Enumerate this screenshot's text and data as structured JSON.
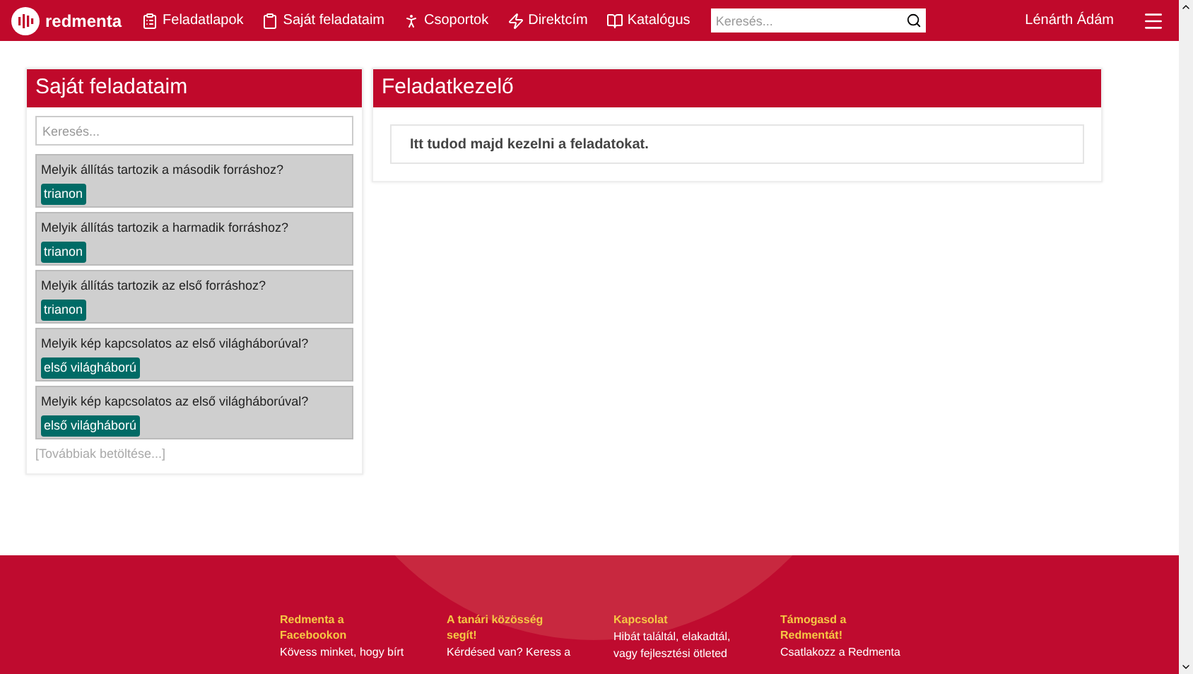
{
  "navbar": {
    "logo": "redmenta",
    "items": [
      {
        "label": "Feladatlapok",
        "kind": "worksheets"
      },
      {
        "label": "Saját feladataim",
        "kind": "tasks"
      },
      {
        "label": "Csoportok",
        "kind": "groups"
      },
      {
        "label": "Direktcím",
        "kind": "direct"
      },
      {
        "label": "Katalógus",
        "kind": "catalog"
      }
    ],
    "search": {
      "placeholder": "Keresés..."
    },
    "user": "Lénárth Ádám"
  },
  "sidebar": {
    "title": "Saját feladataim",
    "search": {
      "placeholder": "Keresés..."
    },
    "tasks": [
      {
        "question": "Melyik állítás tartozik a második forráshoz?",
        "tag": "trianon"
      },
      {
        "question": "Melyik állítás tartozik a harmadik forráshoz?",
        "tag": "trianon"
      },
      {
        "question": "Melyik állítás tartozik az első forráshoz?",
        "tag": "trianon"
      },
      {
        "question": "Melyik kép kapcsolatos az első világháborúval?",
        "tag": "első világháború"
      },
      {
        "question": "Melyik kép kapcsolatos az első világháborúval?",
        "tag": "első világháború"
      }
    ],
    "load_more": "[Továbbiak betöltése...]"
  },
  "main": {
    "title": "Feladatkezelő",
    "message": "Itt tudod majd kezelni a feladatokat."
  },
  "footer": {
    "columns": [
      {
        "heading": "Redmenta a Facebookon",
        "lines": [
          "Kövess minket, hogy bírt"
        ]
      },
      {
        "heading": "A tanári közösség segít!",
        "lines": [
          "Kérdésed van? Keress a"
        ]
      },
      {
        "heading": "Kapcsolat",
        "lines": [
          "Hibát találtál, elakadtál,",
          "vagy fejlesztési ötleted"
        ]
      },
      {
        "heading": "Támogasd a Redmentát!",
        "lines": [
          "Csatlakozz a Redmenta"
        ]
      }
    ]
  }
}
